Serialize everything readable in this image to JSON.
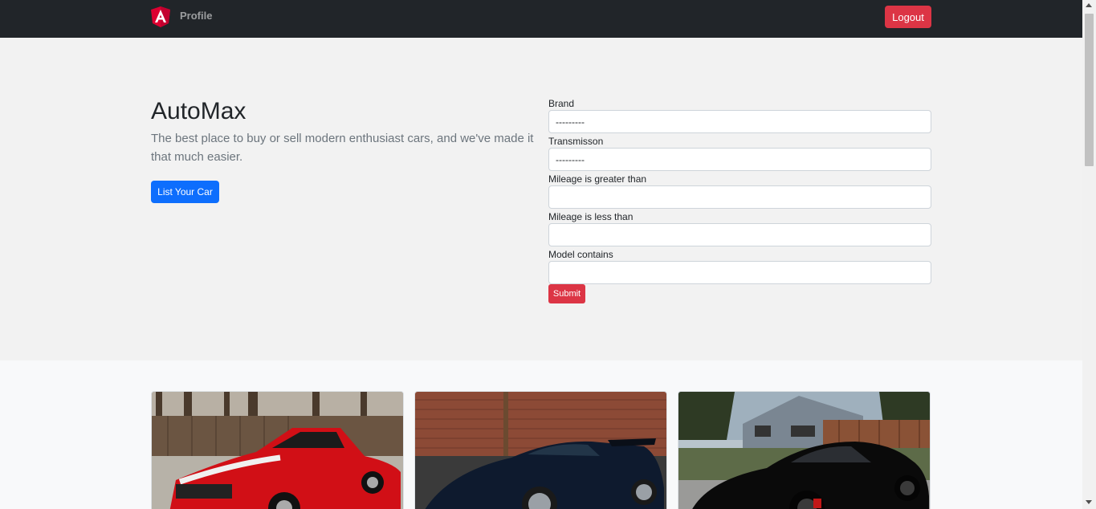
{
  "navbar": {
    "brand_label": "Profile",
    "logout_label": "Logout"
  },
  "hero": {
    "title": "AutoMax",
    "lead": "The best place to buy or sell modern enthusiast cars, and we've made it that much easier.",
    "list_button": "List Your Car"
  },
  "filters": {
    "brand_label": "Brand",
    "brand_value": "---------",
    "transmission_label": "Transmisson",
    "transmission_value": "---------",
    "mileage_gt_label": "Mileage is greater than",
    "mileage_lt_label": "Mileage is less than",
    "model_label": "Model contains",
    "submit_label": "Submit"
  },
  "colors": {
    "navbar": "#212529",
    "danger": "#dc3545",
    "primary": "#0d6efd"
  },
  "listings": [
    {
      "icon": "red-mustang-photo"
    },
    {
      "icon": "dark-blue-supercar-photo"
    },
    {
      "icon": "black-corvette-photo"
    }
  ]
}
